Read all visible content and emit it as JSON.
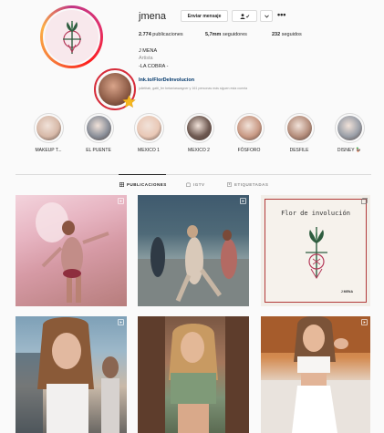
{
  "profile": {
    "username": "jmena",
    "buttons": {
      "message": "Enviar mensaje",
      "follow_icon": "person-check-icon",
      "dropdown_icon": "chevron-down-icon",
      "more_icon": "more-dots-icon"
    },
    "stats": {
      "posts_value": "2.774",
      "posts_label": "publicaciones",
      "followers_value": "5,7mm",
      "followers_label": "seguidores",
      "following_value": "232",
      "following_label": "seguidos"
    },
    "bio": {
      "name": "J MENA",
      "category": "Artista",
      "line1": "-LA COBRA -",
      "line2": "",
      "link": "lnk.to/FlorDeInvolucion",
      "followed_by": "julietitab, gatti_fer betaniaswagner y 161 personas más siguen esta cuenta"
    }
  },
  "highlights": [
    {
      "label": "MAKEUP T...",
      "color": "#d7b9a8"
    },
    {
      "label": "EL PUENTE",
      "color": "#8a8f99"
    },
    {
      "label": "MEXICO 1",
      "color": "#e9c8b6"
    },
    {
      "label": "MEXICO 2",
      "color": "#6f5a52"
    },
    {
      "label": "FÓSFORO",
      "color": "#c99a85"
    },
    {
      "label": "DESFILE",
      "color": "#b58e7c"
    },
    {
      "label": "DISNEY 🦆",
      "color": "#9a9fa8"
    }
  ],
  "tabs": {
    "posts": "PUBLICACIONES",
    "igtv": "IGTV",
    "tagged": "ETIQUETADAS"
  },
  "grid": {
    "card_title": "Flor de involución",
    "card_signature": "J MENA"
  },
  "colors": {
    "annotation_red": "#d62c3a",
    "star_yellow": "#f5b81e",
    "link_blue": "#00376b"
  }
}
